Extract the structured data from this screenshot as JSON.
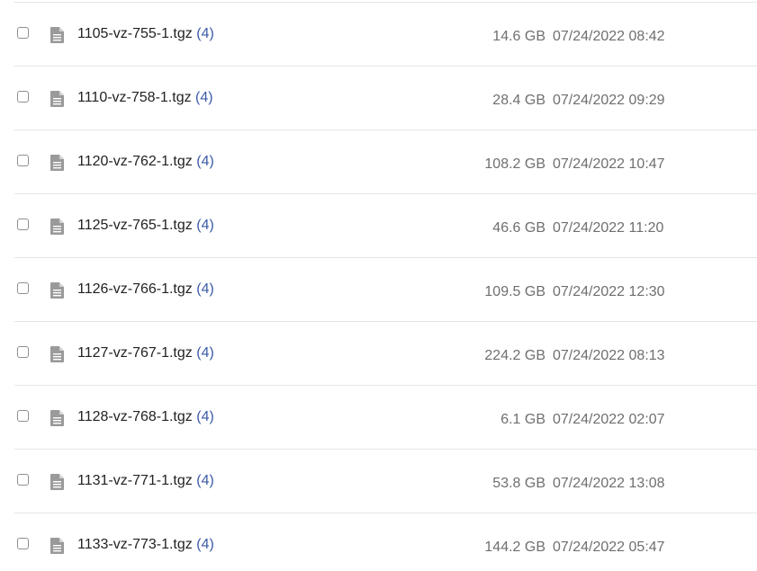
{
  "files": [
    {
      "name": "1105-vz-755-1.tgz",
      "count": "(4)",
      "size": "14.6 GB",
      "date": "07/24/2022 08:42"
    },
    {
      "name": "1110-vz-758-1.tgz",
      "count": "(4)",
      "size": "28.4 GB",
      "date": "07/24/2022 09:29"
    },
    {
      "name": "1120-vz-762-1.tgz",
      "count": "(4)",
      "size": "108.2 GB",
      "date": "07/24/2022 10:47"
    },
    {
      "name": "1125-vz-765-1.tgz",
      "count": "(4)",
      "size": "46.6 GB",
      "date": "07/24/2022 11:20"
    },
    {
      "name": "1126-vz-766-1.tgz",
      "count": "(4)",
      "size": "109.5 GB",
      "date": "07/24/2022 12:30"
    },
    {
      "name": "1127-vz-767-1.tgz",
      "count": "(4)",
      "size": "224.2 GB",
      "date": "07/24/2022 08:13"
    },
    {
      "name": "1128-vz-768-1.tgz",
      "count": "(4)",
      "size": "6.1 GB",
      "date": "07/24/2022 02:07"
    },
    {
      "name": "1131-vz-771-1.tgz",
      "count": "(4)",
      "size": "53.8 GB",
      "date": "07/24/2022 13:08"
    },
    {
      "name": "1133-vz-773-1.tgz",
      "count": "(4)",
      "size": "144.2 GB",
      "date": "07/24/2022 05:47"
    }
  ],
  "icons": {
    "row_icon": "file-document-icon"
  },
  "colors": {
    "count_link": "#3b5ba8",
    "meta_text": "#6f6f6f",
    "name_text": "#222222",
    "divider": "#e6e6e6"
  }
}
